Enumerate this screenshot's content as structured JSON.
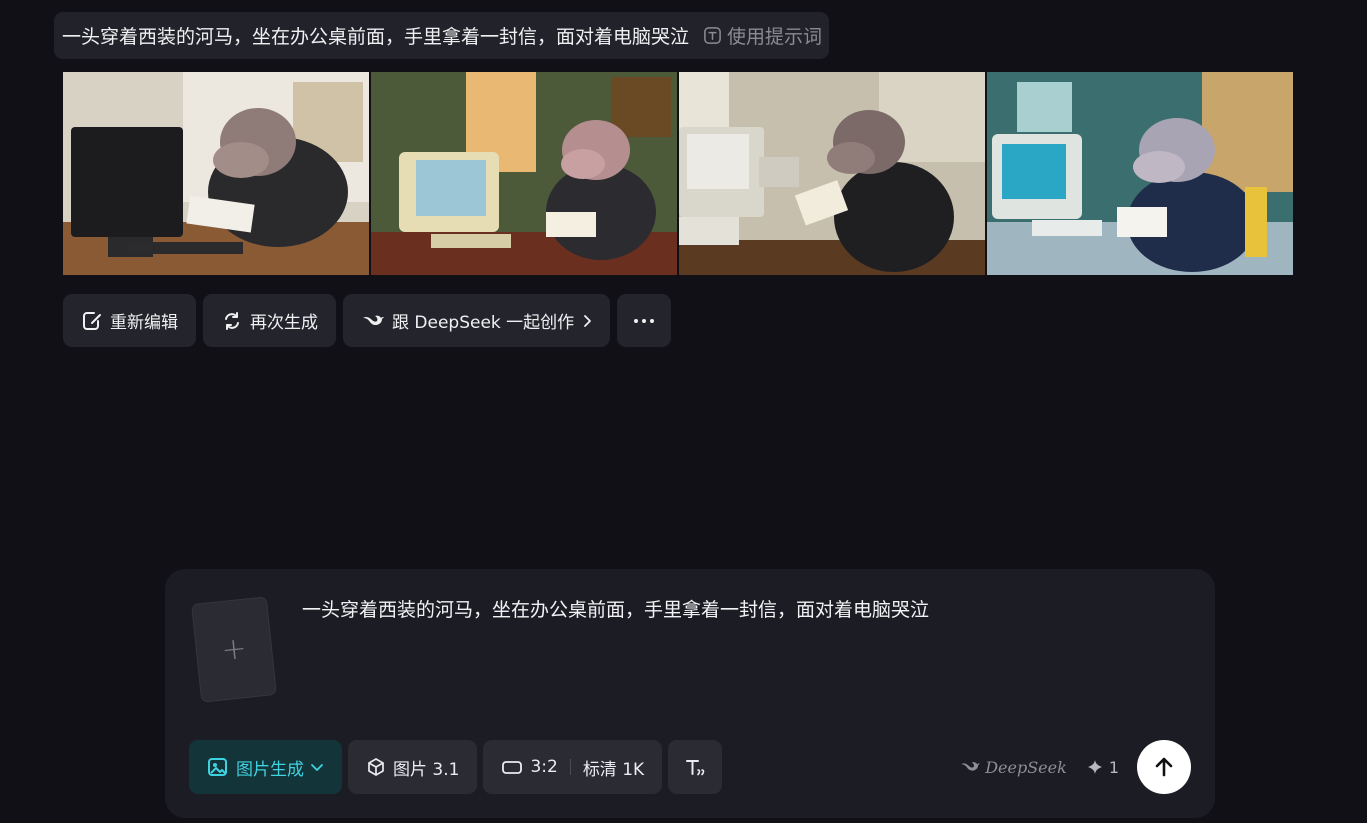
{
  "prompt_chip": {
    "text": "一头穿着西装的河马，坐在办公桌前面，手里拿着一封信，面对着电脑哭泣",
    "use_prompt_label": "使用提示词"
  },
  "actions": {
    "reedit": "重新编辑",
    "regenerate": "再次生成",
    "deepseek_create": "跟 DeepSeek 一起创作"
  },
  "composer": {
    "upload_plus": "+",
    "text": "一头穿着西装的河马，坐在办公桌前面，手里拿着一封信，面对着电脑哭泣",
    "mode_label": "图片生成",
    "model_label": "图片 3.1",
    "ratio_label": "3:2",
    "quality_label": "标清 1K",
    "brand": "DeepSeek",
    "credits": "1"
  },
  "images": [
    {
      "icon": "hippo-at-desk-image-1"
    },
    {
      "icon": "hippo-at-desk-image-2"
    },
    {
      "icon": "hippo-at-desk-image-3"
    },
    {
      "icon": "hippo-at-desk-image-4"
    }
  ],
  "colors": {
    "background": "#101016",
    "accent": "#3fd2e0",
    "panel": "#1c1d24"
  }
}
